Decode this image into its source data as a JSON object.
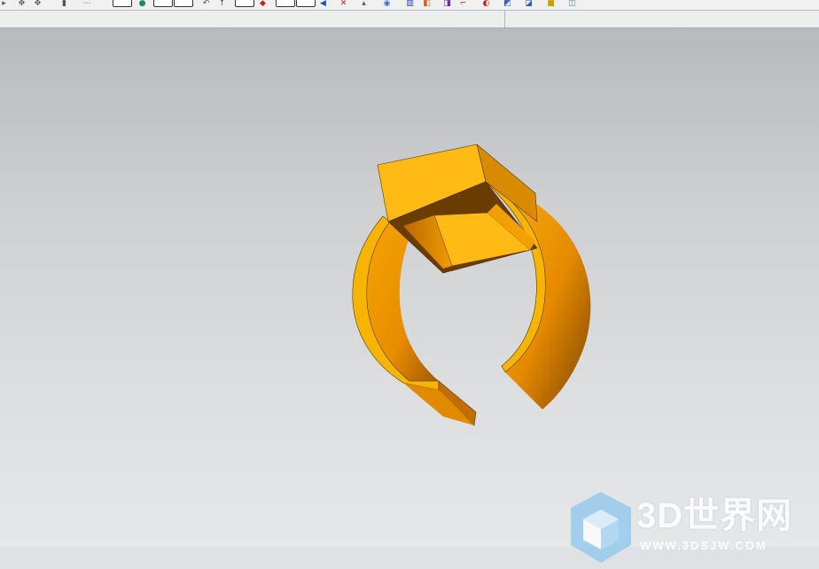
{
  "toolbar": {
    "icons": [
      "undo-icon",
      "move-icon",
      "copy-icon",
      "format-icon",
      "sketch-icon",
      "point-icon",
      "line-icon",
      "arc-icon",
      "circle-icon",
      "rotate-icon",
      "extrude-icon",
      "revolve-icon",
      "blend-icon",
      "chamfer-icon",
      "shell-icon",
      "hole-icon",
      "boss-icon",
      "pad-icon",
      "pocket-icon",
      "slot-icon",
      "rib-icon",
      "groove-icon",
      "trim-icon",
      "view-icon"
    ]
  },
  "viewport": {
    "model_color": "#f5a800",
    "background_top": "#b7b9bc",
    "background_bottom": "#e6e7e9"
  },
  "watermark": {
    "title": "3D世界网",
    "url": "WWW.3DSJW.COM"
  }
}
